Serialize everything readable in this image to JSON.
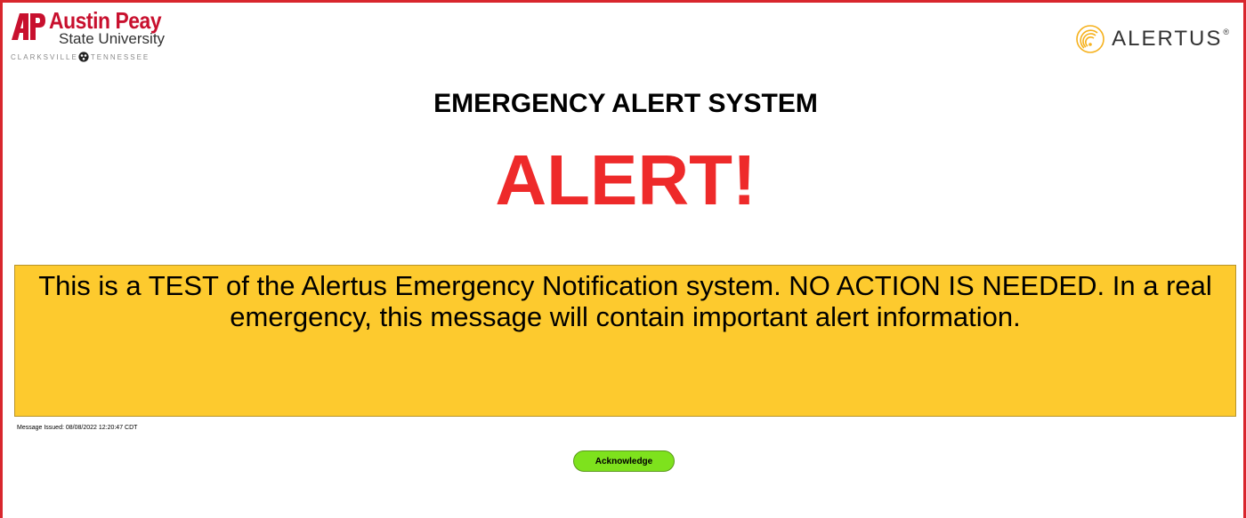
{
  "university": {
    "name": "Austin Peay",
    "subtitle": "State University",
    "location_left": "CLARKSVILLE",
    "location_right": "TENNESSEE"
  },
  "vendor": {
    "name": "ALERTUS",
    "reg_mark": "®"
  },
  "header": {
    "system_title": "EMERGENCY ALERT SYSTEM",
    "alert_title": "ALERT!"
  },
  "message": {
    "text": "This is a TEST of the Alertus Emergency Notification system.  NO ACTION IS NEEDED.  In a real emergency, this message will contain important alert information.",
    "issued": "Message Issued: 08/08/2022 12:20:47 CDT"
  },
  "actions": {
    "acknowledge_label": "Acknowledge"
  },
  "colors": {
    "frame": "#d8262d",
    "alert_red": "#ee2a2a",
    "message_bg": "#fdca2e",
    "button_green": "#7ee21d",
    "university_red": "#c8102e"
  },
  "icons": {
    "university_mark": "ap-logo-icon",
    "state_seal": "tennessee-seal-icon",
    "vendor_mark": "alertus-signal-icon"
  }
}
